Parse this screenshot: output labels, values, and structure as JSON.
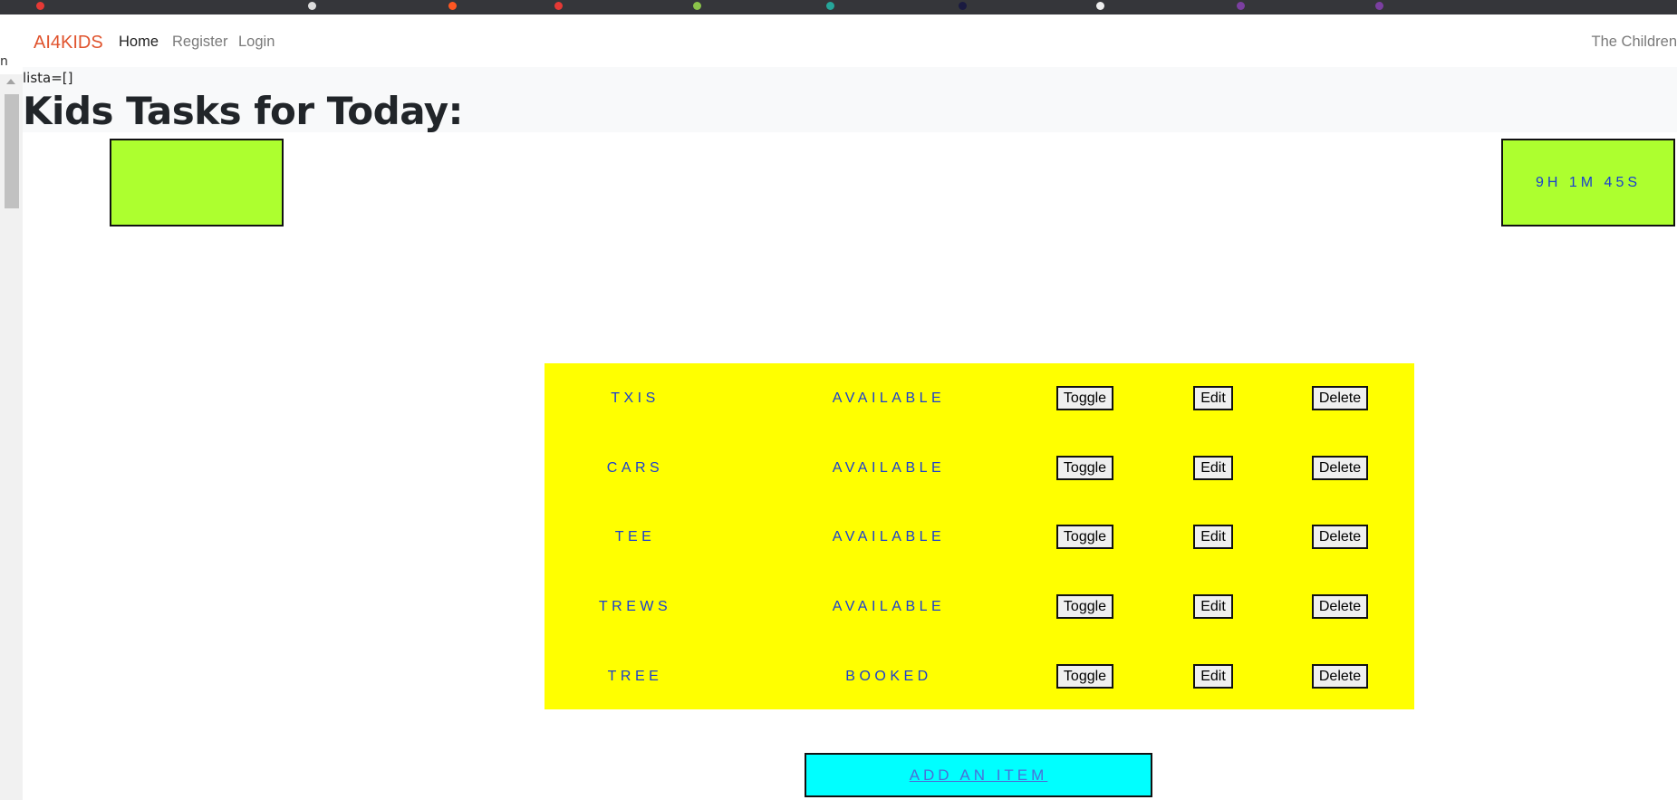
{
  "navbar": {
    "brand": "AI4KIDS",
    "links": [
      {
        "label": "Home"
      },
      {
        "label": "Register"
      },
      {
        "label": "Login"
      }
    ],
    "right_text": "The Children"
  },
  "debug_text": "lista=[]",
  "page_title": "Kids Tasks for Today:",
  "left_box_text": "",
  "timer_text": "9H 1M 45S",
  "tasks": [
    {
      "name": "TXIS",
      "status": "AVAILABLE",
      "toggle": "Toggle",
      "edit": "Edit",
      "delete": "Delete"
    },
    {
      "name": "CARS",
      "status": "AVAILABLE",
      "toggle": "Toggle",
      "edit": "Edit",
      "delete": "Delete"
    },
    {
      "name": "TEE",
      "status": "AVAILABLE",
      "toggle": "Toggle",
      "edit": "Edit",
      "delete": "Delete"
    },
    {
      "name": "TREWS",
      "status": "AVAILABLE",
      "toggle": "Toggle",
      "edit": "Edit",
      "delete": "Delete"
    },
    {
      "name": "TREE",
      "status": "BOOKED",
      "toggle": "Toggle",
      "edit": "Edit",
      "delete": "Delete"
    }
  ],
  "add_button_label": "ADD AN ITEM",
  "colors": {
    "brand": "#e0542e",
    "task_panel": "#ffff00",
    "green_box": "#adff2f",
    "add_button": "#00ffff",
    "task_text": "#1a3fd0"
  }
}
